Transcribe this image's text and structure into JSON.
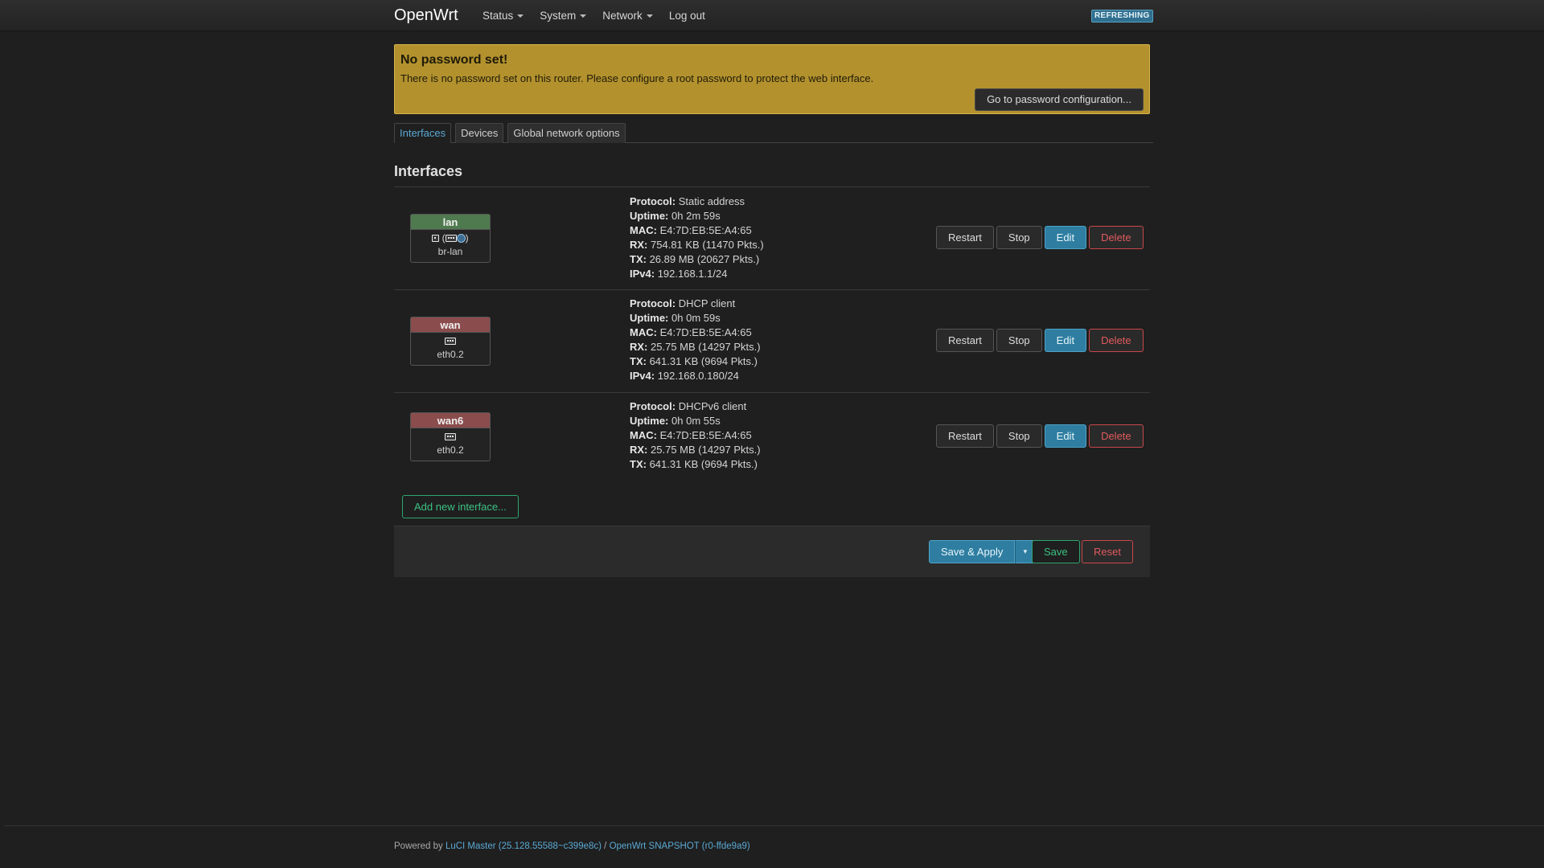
{
  "nav": {
    "brand": "OpenWrt",
    "menu": [
      {
        "label": "Status",
        "dropdown": true
      },
      {
        "label": "System",
        "dropdown": true
      },
      {
        "label": "Network",
        "dropdown": true
      },
      {
        "label": "Log out",
        "dropdown": false
      }
    ],
    "badge": "REFRESHING"
  },
  "alert": {
    "title": "No password set!",
    "text": "There is no password set on this router. Please configure a root password to protect the web interface.",
    "button": "Go to password configuration..."
  },
  "tabs": [
    {
      "label": "Interfaces",
      "active": true
    },
    {
      "label": "Devices",
      "active": false
    },
    {
      "label": "Global network options",
      "active": false
    }
  ],
  "section": {
    "title": "Interfaces"
  },
  "interfaces": [
    {
      "name": "lan",
      "color": "green",
      "device": "br-lan",
      "icons": [
        "bridge-icon",
        "port-icon",
        "wifi-icon"
      ],
      "icons_suffix": ")",
      "protocol": "Static address",
      "uptime": "0h 2m 59s",
      "mac": "E4:7D:EB:5E:A4:65",
      "rx": "754.81 KB (11470 Pkts.)",
      "tx": "26.89 MB (20627 Pkts.)",
      "ipv4": "192.168.1.1/24"
    },
    {
      "name": "wan",
      "color": "red",
      "device": "eth0.2",
      "icons": [
        "port-icon"
      ],
      "protocol": "DHCP client",
      "uptime": "0h 0m 59s",
      "mac": "E4:7D:EB:5E:A4:65",
      "rx": "25.75 MB (14297 Pkts.)",
      "tx": "641.31 KB (9694 Pkts.)",
      "ipv4": "192.168.0.180/24"
    },
    {
      "name": "wan6",
      "color": "red",
      "device": "eth0.2",
      "icons": [
        "port-icon"
      ],
      "protocol": "DHCPv6 client",
      "uptime": "0h 0m 55s",
      "mac": "E4:7D:EB:5E:A4:65",
      "rx": "25.75 MB (14297 Pkts.)",
      "tx": "641.31 KB (9694 Pkts.)"
    }
  ],
  "labels": {
    "protocol": "Protocol:",
    "uptime": "Uptime:",
    "mac": "MAC:",
    "rx": "RX:",
    "tx": "TX:",
    "ipv4": "IPv4:"
  },
  "row_buttons": {
    "restart": "Restart",
    "stop": "Stop",
    "edit": "Edit",
    "delete": "Delete"
  },
  "add_interface": "Add new interface...",
  "actions": {
    "save_apply": "Save & Apply",
    "dropdown": "▾",
    "save": "Save",
    "reset": "Reset"
  },
  "footer": {
    "prefix": "Powered by ",
    "luci": "LuCI Master (25.128.55588~c399e8c)",
    "sep": " / ",
    "openwrt": "OpenWrt SNAPSHOT (r0-ffde9a9)"
  },
  "colors": {
    "accent": "#2f7ea1",
    "warning": "#b3922e",
    "danger": "#c9474a",
    "success": "#2ea56e"
  }
}
